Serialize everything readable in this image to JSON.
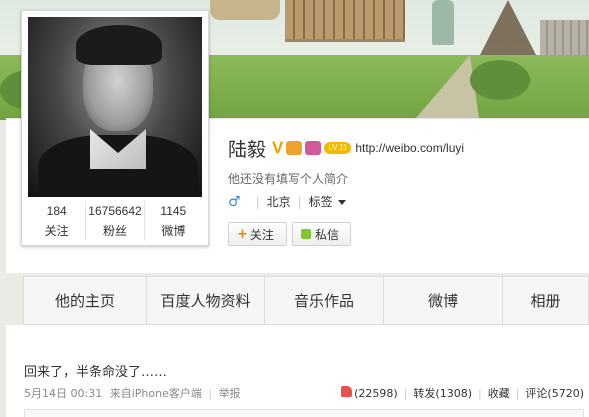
{
  "profile": {
    "name": "陆毅",
    "verified_badge": "V",
    "level_badge": "LV.11",
    "url": "http://weibo.com/luyi",
    "bio": "他还没有填写个人简介",
    "gender_symbol": "♂",
    "location": "北京",
    "tags_label": "标签",
    "stats": [
      {
        "value": "184",
        "label": "关注"
      },
      {
        "value": "16756642",
        "label": "粉丝"
      },
      {
        "value": "1145",
        "label": "微博"
      }
    ],
    "follow_label": "关注",
    "follow_plus": "+",
    "message_label": "私信"
  },
  "tabs": [
    "他的主页",
    "百度人物资料",
    "音乐作品",
    "微博",
    "相册"
  ],
  "post": {
    "text": "回来了，半条命没了……",
    "date": "5月14日 00:31",
    "source": "来自iPhone客户端",
    "report": "举报",
    "likes": "(22598)",
    "repost": "转发(1308)",
    "favorite": "收藏",
    "comment": "评论(5720)"
  }
}
